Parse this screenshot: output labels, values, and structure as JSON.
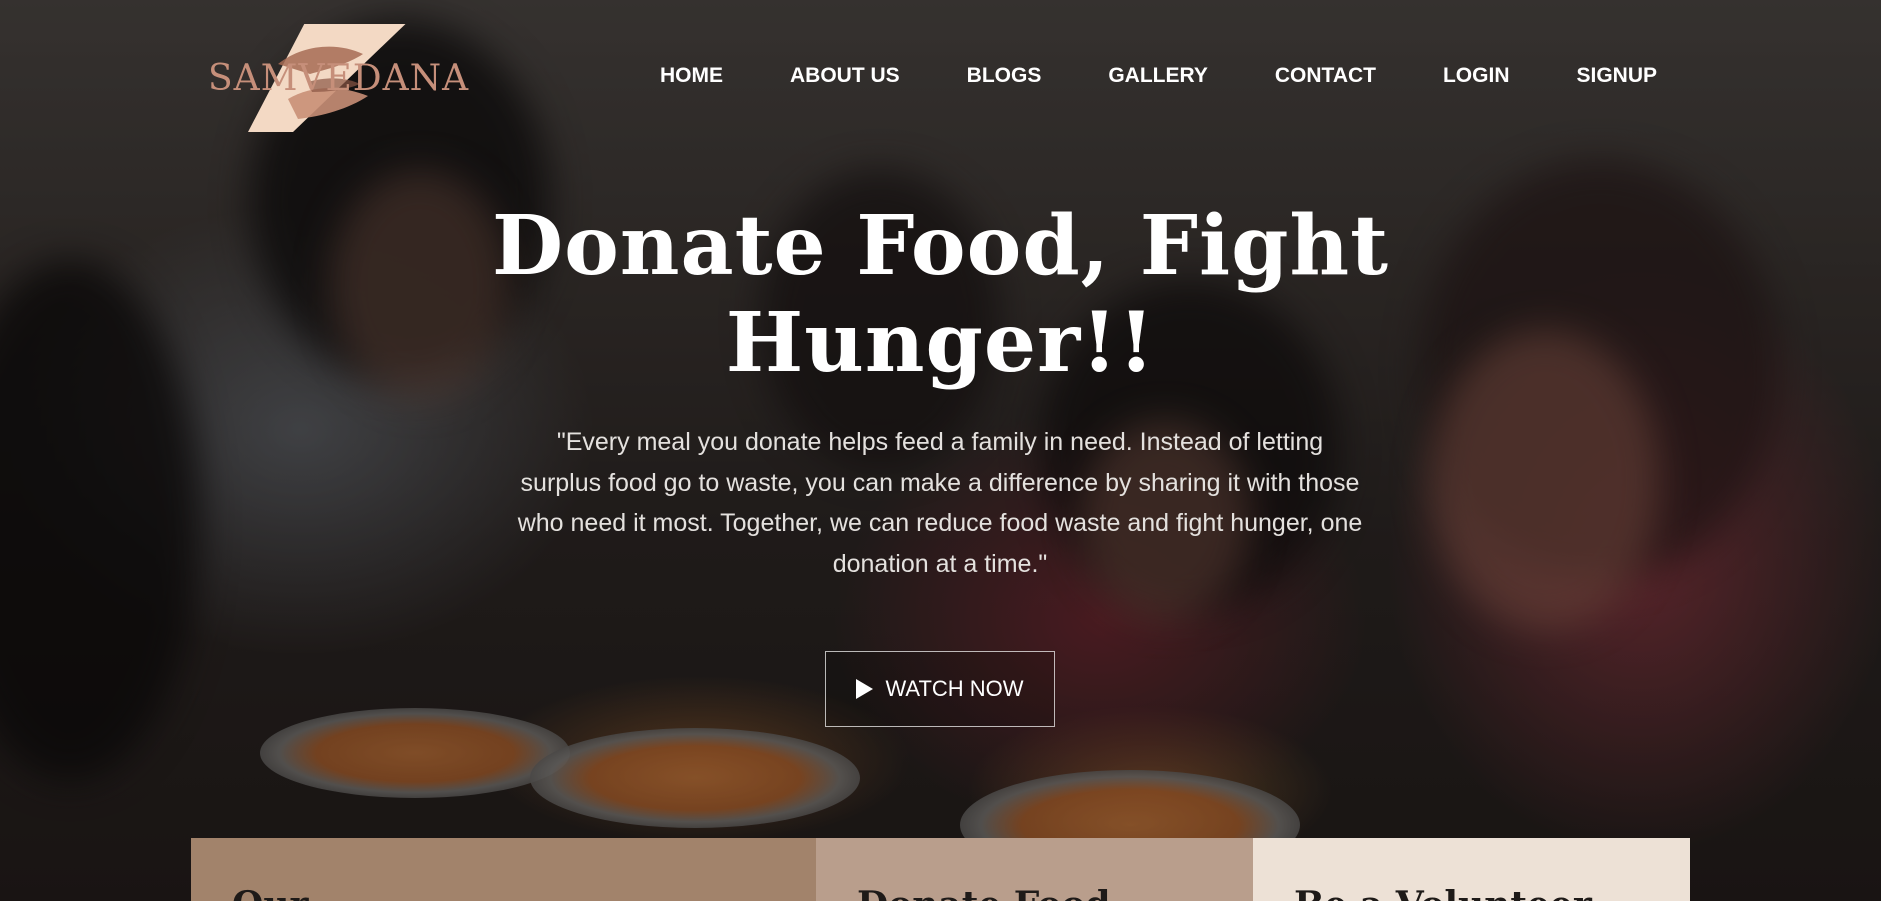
{
  "brand": {
    "logo_text": "SAMVEDANA",
    "logo_color": "#c68f7a"
  },
  "nav": {
    "items": [
      "HOME",
      "ABOUT US",
      "BLOGS",
      "GALLERY",
      "CONTACT",
      "LOGIN",
      "SIGNUP"
    ]
  },
  "hero": {
    "headline_line1": "Donate Food, Fight",
    "headline_line2": "Hunger!!",
    "quote": "\"Every meal you donate helps feed a family in need. Instead of letting surplus food go to waste, you can make a difference by sharing it with those who need it most. Together, we can reduce food waste and fight hunger, one donation at a time.\"",
    "watch_button_label": "WATCH NOW",
    "watch_button_icon": "play-icon"
  },
  "cards": [
    {
      "title": "Our",
      "color": "#a2836b"
    },
    {
      "title": "Donate Food",
      "color": "#b99e8c"
    },
    {
      "title": "Be a Volunteer",
      "color": "#ede1d6"
    }
  ]
}
